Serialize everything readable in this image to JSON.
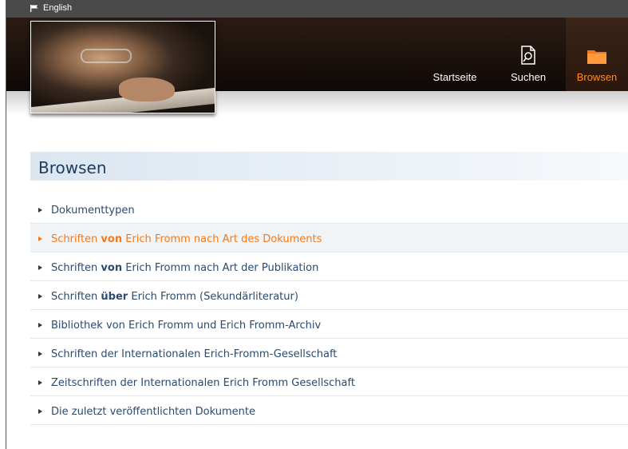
{
  "topbar": {
    "language": "English"
  },
  "nav": [
    {
      "label": "Startseite"
    },
    {
      "label": "Suchen"
    },
    {
      "label": "Browsen"
    }
  ],
  "colors": {
    "accent": "#f27a1a",
    "title_text": "#1f3c5e",
    "link_text": "#2b4a6e"
  },
  "page_title": "Browsen",
  "items": [
    {
      "pre": "Dokumenttypen",
      "bold": "",
      "post": ""
    },
    {
      "pre": "Schriften ",
      "bold": "von",
      "post": " Erich Fromm nach Art des Dokuments"
    },
    {
      "pre": "Schriften ",
      "bold": "von",
      "post": " Erich Fromm nach Art der Publikation"
    },
    {
      "pre": "Schriften ",
      "bold": "über",
      "post": " Erich Fromm (Sekundärliteratur)"
    },
    {
      "pre": "Bibliothek von Erich Fromm und Erich Fromm-Archiv",
      "bold": "",
      "post": ""
    },
    {
      "pre": "Schriften der Internationalen Erich-Fromm-Gesellschaft",
      "bold": "",
      "post": ""
    },
    {
      "pre": "Zeitschriften der Internationalen Erich Fromm Gesellschaft",
      "bold": "",
      "post": ""
    },
    {
      "pre": "Die zuletzt veröffentlichten Dokumente",
      "bold": "",
      "post": ""
    }
  ]
}
